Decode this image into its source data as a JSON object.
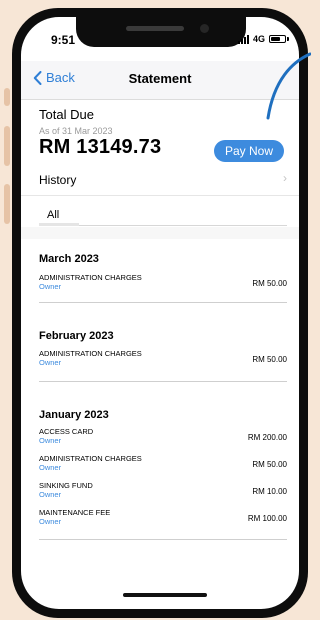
{
  "status_bar": {
    "time": "9:51",
    "network": "4G"
  },
  "nav": {
    "back_label": "Back",
    "title": "Statement"
  },
  "due": {
    "title": "Total Due",
    "as_of": "As of 31 Mar 2023",
    "amount": "RM 13149.73",
    "pay_label": "Pay Now"
  },
  "history": {
    "label": "History"
  },
  "tabs": {
    "all_label": "All"
  },
  "sections": [
    {
      "month": "March 2023",
      "entries": [
        {
          "name": "ADMINISTRATION CHARGES",
          "role": "Owner",
          "amount": "RM 50.00"
        }
      ]
    },
    {
      "month": "February 2023",
      "entries": [
        {
          "name": "ADMINISTRATION CHARGES",
          "role": "Owner",
          "amount": "RM 50.00"
        }
      ]
    },
    {
      "month": "January 2023",
      "entries": [
        {
          "name": "ACCESS CARD",
          "role": "Owner",
          "amount": "RM 200.00"
        },
        {
          "name": "ADMINISTRATION CHARGES",
          "role": "Owner",
          "amount": "RM 50.00"
        },
        {
          "name": "SINKING FUND",
          "role": "Owner",
          "amount": "RM 10.00"
        },
        {
          "name": "MAINTENANCE FEE",
          "role": "Owner",
          "amount": "RM 100.00"
        }
      ]
    }
  ],
  "colors": {
    "background": "#f7e6d6",
    "accent": "#3d8bde",
    "link": "#2f7fd6",
    "annotation_curve": "#1f6fbf"
  }
}
